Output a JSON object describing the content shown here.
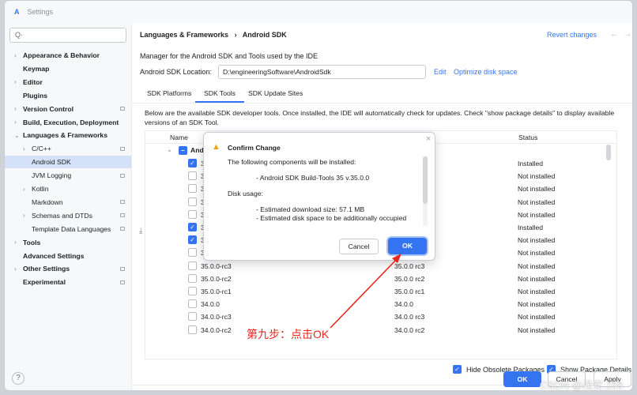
{
  "window": {
    "title": "Settings"
  },
  "sidebar": {
    "search_placeholder": "Q·",
    "items": [
      {
        "label": "Appearance & Behavior",
        "chev": true,
        "bold": true,
        "indent": 0,
        "pin": false
      },
      {
        "label": "Keymap",
        "chev": false,
        "bold": true,
        "indent": 0,
        "pin": false
      },
      {
        "label": "Editor",
        "chev": true,
        "bold": true,
        "indent": 0,
        "pin": false
      },
      {
        "label": "Plugins",
        "chev": false,
        "bold": true,
        "indent": 0,
        "pin": false
      },
      {
        "label": "Version Control",
        "chev": true,
        "bold": true,
        "indent": 0,
        "pin": true
      },
      {
        "label": "Build, Execution, Deployment",
        "chev": true,
        "bold": true,
        "indent": 0,
        "pin": false
      },
      {
        "label": "Languages & Frameworks",
        "chev": "open",
        "bold": true,
        "indent": 0,
        "pin": false
      },
      {
        "label": "C/C++",
        "chev": true,
        "bold": false,
        "indent": 1,
        "pin": true
      },
      {
        "label": "Android SDK",
        "chev": false,
        "bold": false,
        "indent": 1,
        "pin": false,
        "selected": true
      },
      {
        "label": "JVM Logging",
        "chev": false,
        "bold": false,
        "indent": 1,
        "pin": true
      },
      {
        "label": "Kotlin",
        "chev": true,
        "bold": false,
        "indent": 1,
        "pin": false
      },
      {
        "label": "Markdown",
        "chev": false,
        "bold": false,
        "indent": 1,
        "pin": true
      },
      {
        "label": "Schemas and DTDs",
        "chev": true,
        "bold": false,
        "indent": 1,
        "pin": true
      },
      {
        "label": "Template Data Languages",
        "chev": false,
        "bold": false,
        "indent": 1,
        "pin": true
      },
      {
        "label": "Tools",
        "chev": true,
        "bold": true,
        "indent": 0,
        "pin": false
      },
      {
        "label": "Advanced Settings",
        "chev": false,
        "bold": true,
        "indent": 0,
        "pin": false
      },
      {
        "label": "Other Settings",
        "chev": true,
        "bold": true,
        "indent": 0,
        "pin": true
      },
      {
        "label": "Experimental",
        "chev": false,
        "bold": true,
        "indent": 0,
        "pin": true
      }
    ],
    "help": "?"
  },
  "main": {
    "breadcrumb_parent": "Languages & Frameworks",
    "breadcrumb_sep": "›",
    "breadcrumb_current": "Android SDK",
    "revert": "Revert changes",
    "back": "←",
    "forward": "→",
    "description": "Manager for the Android SDK and Tools used by the IDE",
    "location_label": "Android SDK Location:",
    "location_value": "D:\\engineeringSoftware\\AndroidSdk",
    "edit": "Edit",
    "optimize": "Optimize disk space",
    "tabs": [
      "SDK Platforms",
      "SDK Tools",
      "SDK Update Sites"
    ],
    "info": "Below are the available SDK developer tools. Once installed, the IDE will automatically check for updates. Check \"show package details\" to display available versions of an SDK Tool.",
    "columns": {
      "name": "Name",
      "status": "Status"
    },
    "group": {
      "label": "Andr"
    },
    "rows": [
      {
        "name": "36",
        "version": "",
        "status": "Installed",
        "checked": true
      },
      {
        "name": "36",
        "version": "",
        "status": "Not installed",
        "checked": false
      },
      {
        "name": "36",
        "version": "",
        "status": "Not installed",
        "checked": false
      },
      {
        "name": "36",
        "version": "",
        "status": "Not installed",
        "checked": false
      },
      {
        "name": "36",
        "version": "",
        "status": "Not installed",
        "checked": false
      },
      {
        "name": "35",
        "version": "",
        "status": "Installed",
        "checked": true
      },
      {
        "name": "35",
        "version": "",
        "status": "Not installed",
        "checked": true,
        "download": true
      },
      {
        "name": "35",
        "version": "",
        "status": "Not installed",
        "checked": false
      },
      {
        "name": "35.0.0-rc3",
        "version": "35.0.0 rc3",
        "status": "Not installed",
        "checked": false
      },
      {
        "name": "35.0.0-rc2",
        "version": "35.0.0 rc2",
        "status": "Not installed",
        "checked": false
      },
      {
        "name": "35.0.0-rc1",
        "version": "35.0.0 rc1",
        "status": "Not installed",
        "checked": false
      },
      {
        "name": "34.0.0",
        "version": "34.0.0",
        "status": "Not installed",
        "checked": false
      },
      {
        "name": "34.0.0-rc3",
        "version": "34.0.0 rc3",
        "status": "Not installed",
        "checked": false
      },
      {
        "name": "34.0.0-rc2",
        "version": "34.0.0 rc2",
        "status": "Not installed",
        "checked": false
      }
    ],
    "hide_obsolete": "Hide Obsolete Packages",
    "show_details": "Show Package Details",
    "ok": "OK",
    "cancel": "Cancel",
    "apply": "Apply"
  },
  "dialog": {
    "title": "Confirm Change",
    "line1": "The following components will be installed:",
    "component": "- Android SDK Build-Tools 35 v.35.0.0",
    "disk": "Disk usage:",
    "download": "- Estimated download size: 57.1 MB",
    "occupied": "- Estimated disk space to be additionally occupied",
    "cancel": "Cancel",
    "ok": "OK",
    "close": "×"
  },
  "annotation": "第九步：点击OK",
  "watermark": "CSDN @浅安.158",
  "colors": {
    "accent": "#3574f0",
    "annotation": "#e8261c"
  }
}
